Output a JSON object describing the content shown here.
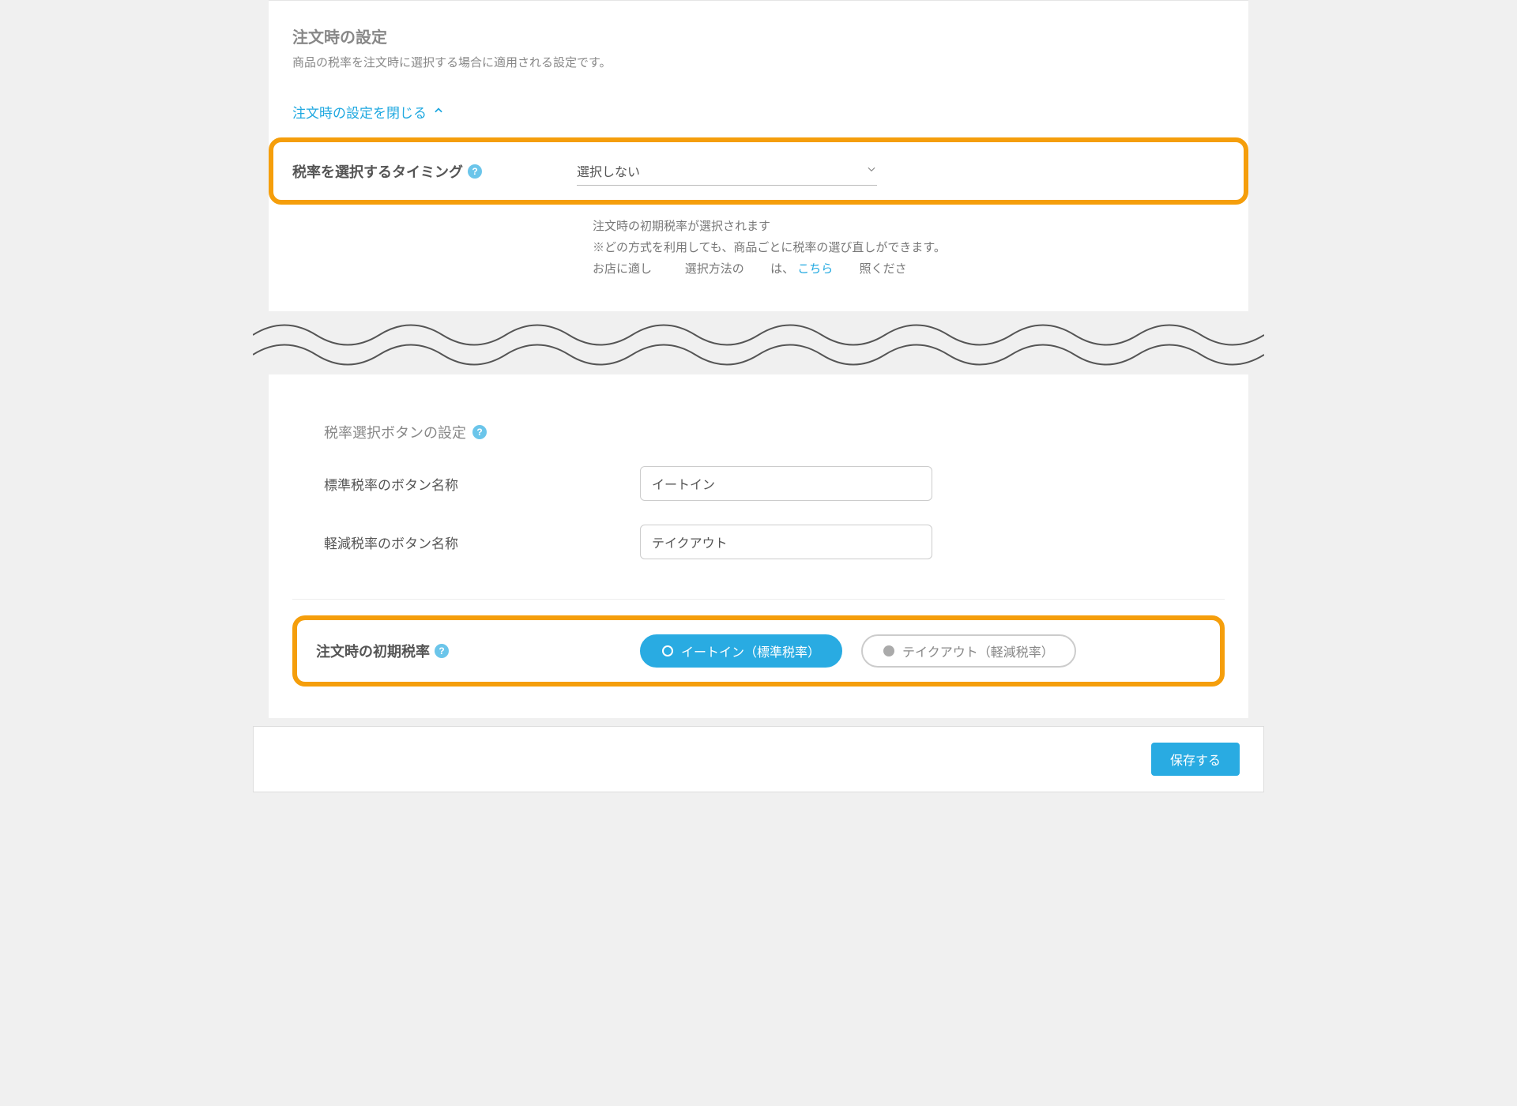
{
  "section": {
    "title": "注文時の設定",
    "desc": "商品の税率を注文時に選択する場合に適用される設定です。"
  },
  "collapse": {
    "label": "注文時の設定を閉じる"
  },
  "timing": {
    "label": "税率を選択するタイミング",
    "value": "選択しない",
    "under1": "注文時の初期税率が選択されます",
    "under2a": "※どの方式を利用しても、商品ごとに税率の選び直しができます。",
    "under3_pre": "お店に適し",
    "under3_mid1": "選択方法の",
    "under3_mid2": "は、",
    "under3_link": "こちら",
    "under3_after": "照くださ"
  },
  "button_settings": {
    "title": "税率選択ボタンの設定",
    "std_label": "標準税率のボタン名称",
    "std_value": "イートイン",
    "reduced_label": "軽減税率のボタン名称",
    "reduced_value": "テイクアウト"
  },
  "initial_rate": {
    "label": "注文時の初期税率",
    "opt1": "イートイン（標準税率）",
    "opt2": "テイクアウト（軽減税率）"
  },
  "footer": {
    "save": "保存する"
  }
}
